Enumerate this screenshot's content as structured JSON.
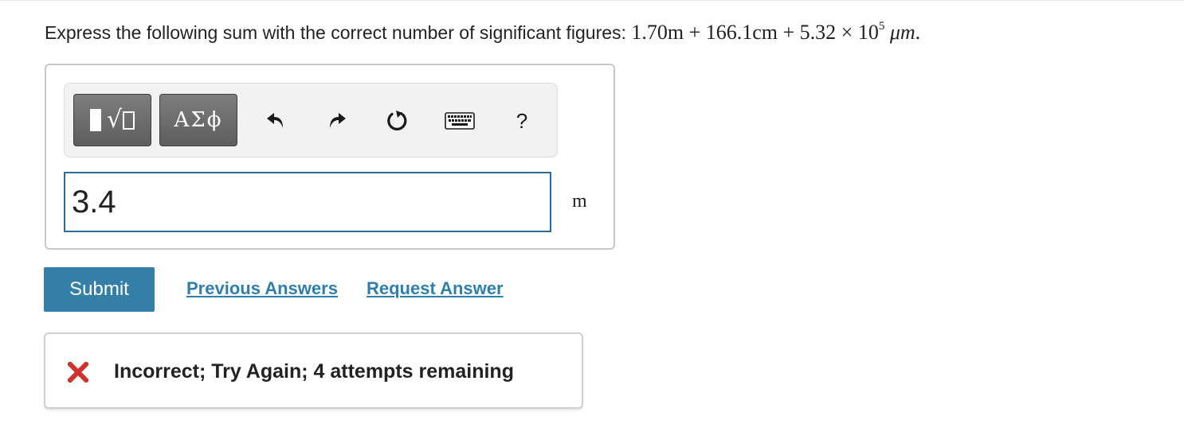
{
  "question": {
    "prompt": "Express the following sum with the correct number of significant figures:",
    "term1": "1.70m",
    "plus1": "+",
    "term2": "166.1cm",
    "plus2": "+",
    "term3_coeff": "5.32",
    "times": "×",
    "term3_base": "10",
    "term3_exp": "5",
    "term3_unit": "μm",
    "end": "."
  },
  "toolbar": {
    "templates_icon": "templates-sqrt-icon",
    "symbols_label": "ΑΣϕ",
    "undo_icon": "undo-icon",
    "redo_icon": "redo-icon",
    "reset_icon": "reset-icon",
    "keyboard_icon": "keyboard-icon",
    "help_label": "?"
  },
  "answer": {
    "value": "3.4",
    "unit": "m"
  },
  "actions": {
    "submit_label": "Submit",
    "previous_answers_label": "Previous Answers",
    "request_answer_label": "Request Answer"
  },
  "feedback": {
    "icon": "incorrect-x-icon",
    "message": "Incorrect; Try Again; 4 attempts remaining",
    "color": "#d0322d"
  },
  "colors": {
    "submit_bg": "#337fa8",
    "link": "#2f7fad",
    "input_border": "#2d6d93"
  }
}
